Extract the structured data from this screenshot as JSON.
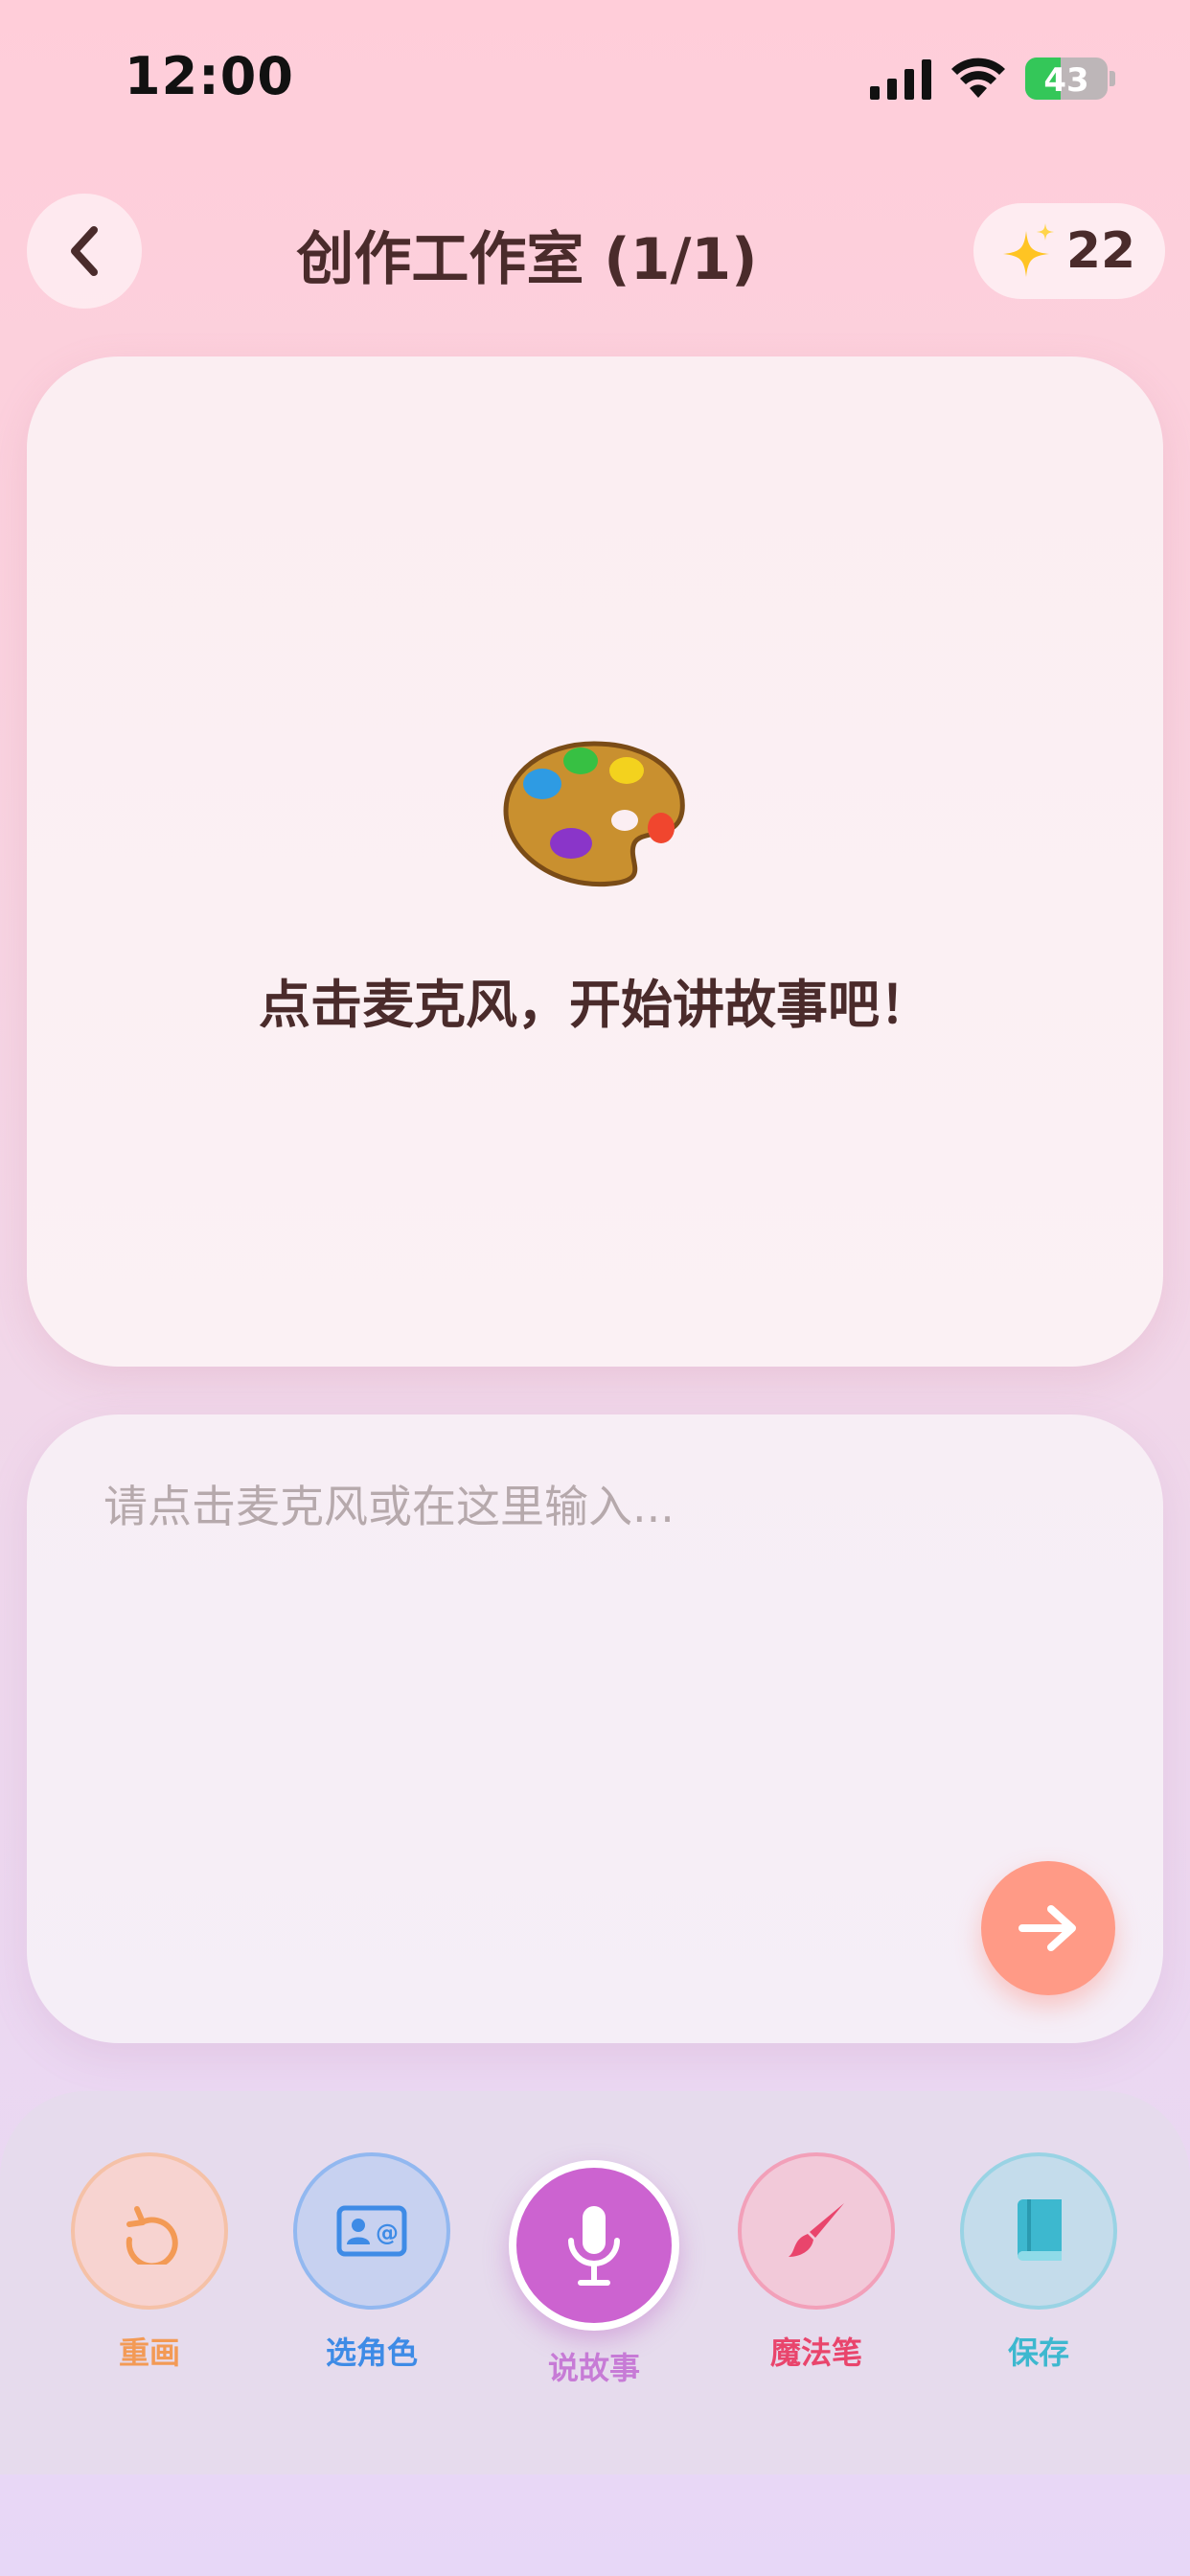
{
  "status_bar": {
    "time": "12:00",
    "battery": "43",
    "battery_level": 0.43
  },
  "header": {
    "title": "创作工作室 (1/1)",
    "credits": "22",
    "back_icon": "chevron-left-icon",
    "credits_icon": "sparkles-icon"
  },
  "canvas": {
    "icon": "palette-icon",
    "hint": "点击麦克风，开始讲故事吧！"
  },
  "input": {
    "placeholder": "请点击麦克风或在这里输入...",
    "value": "",
    "send_icon": "arrow-right-icon"
  },
  "toolbar": {
    "items": [
      {
        "label": "重画",
        "icon": "redo-icon",
        "color": "#f39a55"
      },
      {
        "label": "选角色",
        "icon": "contact-card-icon",
        "color": "#3e8be6"
      },
      {
        "label": "说故事",
        "icon": "microphone-icon",
        "color": "#c77bd6"
      },
      {
        "label": "魔法笔",
        "icon": "paintbrush-icon",
        "color": "#e9456c"
      },
      {
        "label": "保存",
        "icon": "book-icon",
        "color": "#3db8cf"
      }
    ]
  },
  "colors": {
    "accent": "#cc63d0",
    "send": "#ff9a86",
    "title": "#4a2b2b"
  }
}
